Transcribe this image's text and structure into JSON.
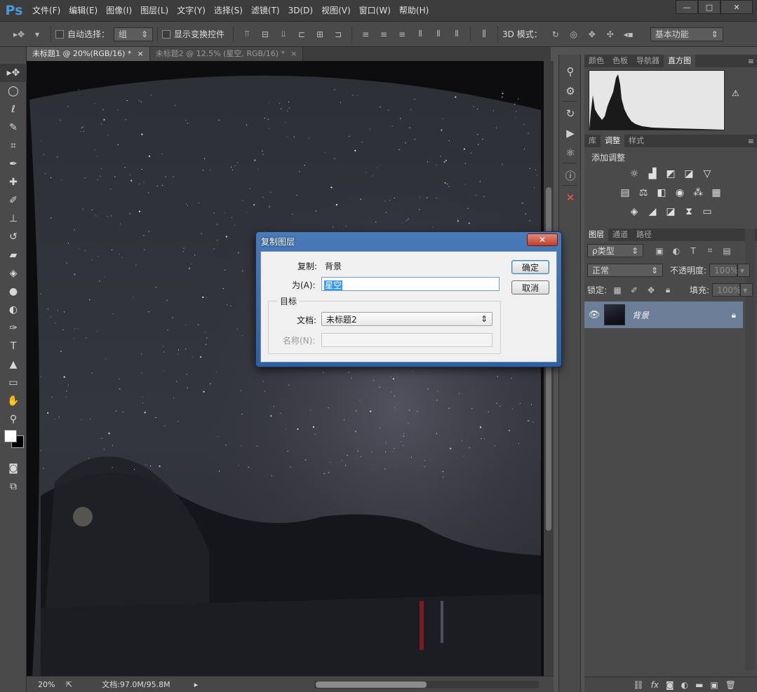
{
  "app": {
    "logo": "Ps"
  },
  "menu": [
    "文件(F)",
    "编辑(E)",
    "图像(I)",
    "图层(L)",
    "文字(Y)",
    "选择(S)",
    "滤镜(T)",
    "3D(D)",
    "视图(V)",
    "窗口(W)",
    "帮助(H)"
  ],
  "window_controls": {
    "minimize": "—",
    "maximize": "□",
    "close": "✕"
  },
  "options": {
    "auto_select_label": "自动选择：",
    "auto_select_value": "组",
    "show_transform_label": "显示变换控件",
    "mode3d_label": "3D 模式：",
    "workspace": "基本功能"
  },
  "tabs": [
    {
      "label": "未标题1 @ 20%(RGB/16) *",
      "close": "×"
    },
    {
      "label": "未标题2 @ 12.5% (星空, RGB/16) *",
      "close": "×"
    }
  ],
  "status": {
    "zoom": "20%",
    "doc": "文档:97.0M/95.8M"
  },
  "panels": {
    "top_tabs": [
      "颜色",
      "色板",
      "导航器",
      "直方图"
    ],
    "mid_tabs": [
      "库",
      "调整",
      "样式"
    ],
    "adjust_title": "添加调整",
    "layer_tabs": [
      "图层",
      "通道",
      "路径"
    ],
    "kind_filter": "ρ类型",
    "blend_mode": "正常",
    "opacity_label": "不透明度:",
    "opacity_value": "100%",
    "lock_label": "锁定:",
    "fill_label": "填充:",
    "fill_value": "100%",
    "layer_name": "背景"
  },
  "dialog": {
    "title": "复制图层",
    "close": "✕",
    "copy_label": "复制:",
    "copy_value": "背景",
    "as_label": "为(A):",
    "as_value": "星空",
    "ok": "确定",
    "cancel": "取消",
    "group_label": "目标",
    "doc_label": "文档:",
    "doc_value": "未标题2",
    "name_label": "名称(N):"
  }
}
